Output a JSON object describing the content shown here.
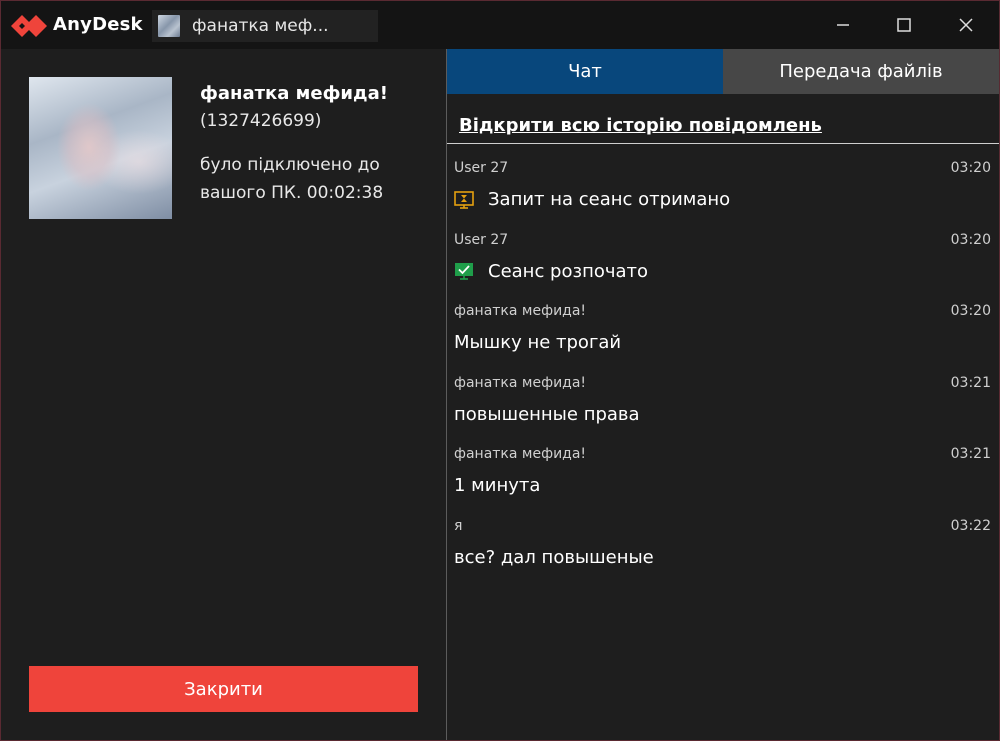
{
  "app": {
    "title": "AnyDesk",
    "brand_color": "#ef443b"
  },
  "session_tab": {
    "label": "фанатка меф..."
  },
  "window_controls": {
    "minimize": "minimize-icon",
    "maximize": "maximize-icon",
    "close": "close-icon"
  },
  "peer": {
    "name": "фанатка мефида!",
    "id": "(1327426699)",
    "status": "було підключено до вашого ПК. 00:02:38"
  },
  "close_button": {
    "label": "Закрити"
  },
  "tabs": [
    {
      "label": "Чат",
      "active": true
    },
    {
      "label": "Передача файлів",
      "active": false
    }
  ],
  "history_link": "Відкрити всю історію повідомлень",
  "messages": [
    {
      "user": "User 27",
      "time": "03:20",
      "text": "Запит на сеанс отримано",
      "icon": "hourglass-icon"
    },
    {
      "user": "User 27",
      "time": "03:20",
      "text": "Сеанс розпочато",
      "icon": "monitor-check-icon"
    },
    {
      "user": "фанатка мефида!",
      "time": "03:20",
      "text": "Мышку не трогай"
    },
    {
      "user": "фанатка мефида!",
      "time": "03:21",
      "text": "повышенные права"
    },
    {
      "user": "фанатка мефида!",
      "time": "03:21",
      "text": "1 минута"
    },
    {
      "user": "я",
      "time": "03:22",
      "text": "все? дал повышеные"
    }
  ]
}
